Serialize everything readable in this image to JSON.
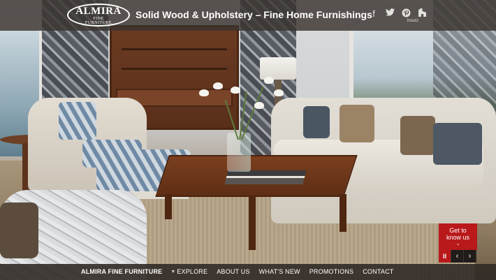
{
  "header": {
    "logo": {
      "main": "ALMIRA",
      "sub1": "FINE",
      "sub2": "FURNITURE"
    },
    "tagline": "Solid Wood & Upholstery – Fine Home Furnishings",
    "social": [
      {
        "icon": "facebook-icon",
        "glyph": "f"
      },
      {
        "icon": "twitter-icon",
        "glyph": ""
      },
      {
        "icon": "pinterest-icon",
        "glyph": ""
      },
      {
        "icon": "houzz-icon",
        "glyph": ""
      }
    ],
    "houzz_label": "houzz"
  },
  "nav": {
    "brand": "ALMIRA FINE FURNITURE",
    "caret": "▼",
    "items": [
      "EXPLORE",
      "ABOUT US",
      "WHAT'S NEW",
      "PROMOTIONS",
      "CONTACT"
    ]
  },
  "cta": {
    "line1": "Get to",
    "line2": "know us",
    "chevron": "⌄"
  },
  "slider_controls": {
    "pause": "II",
    "prev": "‹",
    "next": "›"
  },
  "colors": {
    "accent": "#b9191b",
    "header_bg": "#3a3430",
    "nav_bg": "#302a26"
  }
}
